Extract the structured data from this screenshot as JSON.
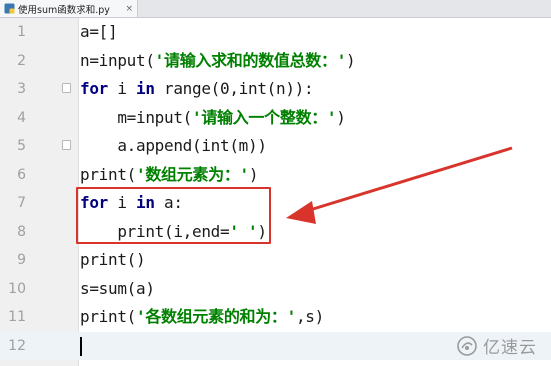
{
  "tab": {
    "title": "使用sum函数求和.py",
    "close_glyph": "×",
    "icon": "python-file-icon"
  },
  "code_lines": [
    {
      "num": "1",
      "parts": [
        {
          "t": "a=[]",
          "c": "plain"
        }
      ]
    },
    {
      "num": "2",
      "parts": [
        {
          "t": "n=input(",
          "c": "plain"
        },
        {
          "t": "'请输入求和的数值总数：'",
          "c": "str"
        },
        {
          "t": ")",
          "c": "plain"
        }
      ]
    },
    {
      "num": "3",
      "parts": [
        {
          "t": "for",
          "c": "kw"
        },
        {
          "t": " i ",
          "c": "plain"
        },
        {
          "t": "in",
          "c": "kw"
        },
        {
          "t": " range(0,int(n)):",
          "c": "plain"
        }
      ]
    },
    {
      "num": "4",
      "parts": [
        {
          "t": "    m=input(",
          "c": "plain"
        },
        {
          "t": "'请输入一个整数：'",
          "c": "str"
        },
        {
          "t": ")",
          "c": "plain"
        }
      ]
    },
    {
      "num": "5",
      "parts": [
        {
          "t": "    a.append(int(m))",
          "c": "plain"
        }
      ]
    },
    {
      "num": "6",
      "parts": [
        {
          "t": "print(",
          "c": "plain"
        },
        {
          "t": "'数组元素为：'",
          "c": "str"
        },
        {
          "t": ")",
          "c": "plain"
        }
      ]
    },
    {
      "num": "7",
      "parts": [
        {
          "t": "for",
          "c": "kw"
        },
        {
          "t": " i ",
          "c": "plain"
        },
        {
          "t": "in",
          "c": "kw"
        },
        {
          "t": " a:",
          "c": "plain"
        }
      ]
    },
    {
      "num": "8",
      "parts": [
        {
          "t": "    print(i,end=",
          "c": "plain"
        },
        {
          "t": "' '",
          "c": "str"
        },
        {
          "t": ")",
          "c": "plain"
        }
      ]
    },
    {
      "num": "9",
      "parts": [
        {
          "t": "print()",
          "c": "plain"
        }
      ]
    },
    {
      "num": "10",
      "parts": [
        {
          "t": "s=sum(a)",
          "c": "plain"
        }
      ]
    },
    {
      "num": "11",
      "parts": [
        {
          "t": "print(",
          "c": "plain"
        },
        {
          "t": "'各数组元素的和为：'",
          "c": "str"
        },
        {
          "t": ",s)",
          "c": "plain"
        }
      ]
    },
    {
      "num": "12",
      "parts": []
    }
  ],
  "fold_lines": [
    "3",
    "5"
  ],
  "current_line": "12",
  "annotation": {
    "box_color": "#d9342b",
    "arrow_color": "#d9342b"
  },
  "watermark": {
    "text": "亿速云",
    "icon": "yisu-cloud-logo-icon"
  },
  "colors": {
    "keyword": "#000080",
    "string": "#008000",
    "line_number": "#a0a0a0"
  }
}
